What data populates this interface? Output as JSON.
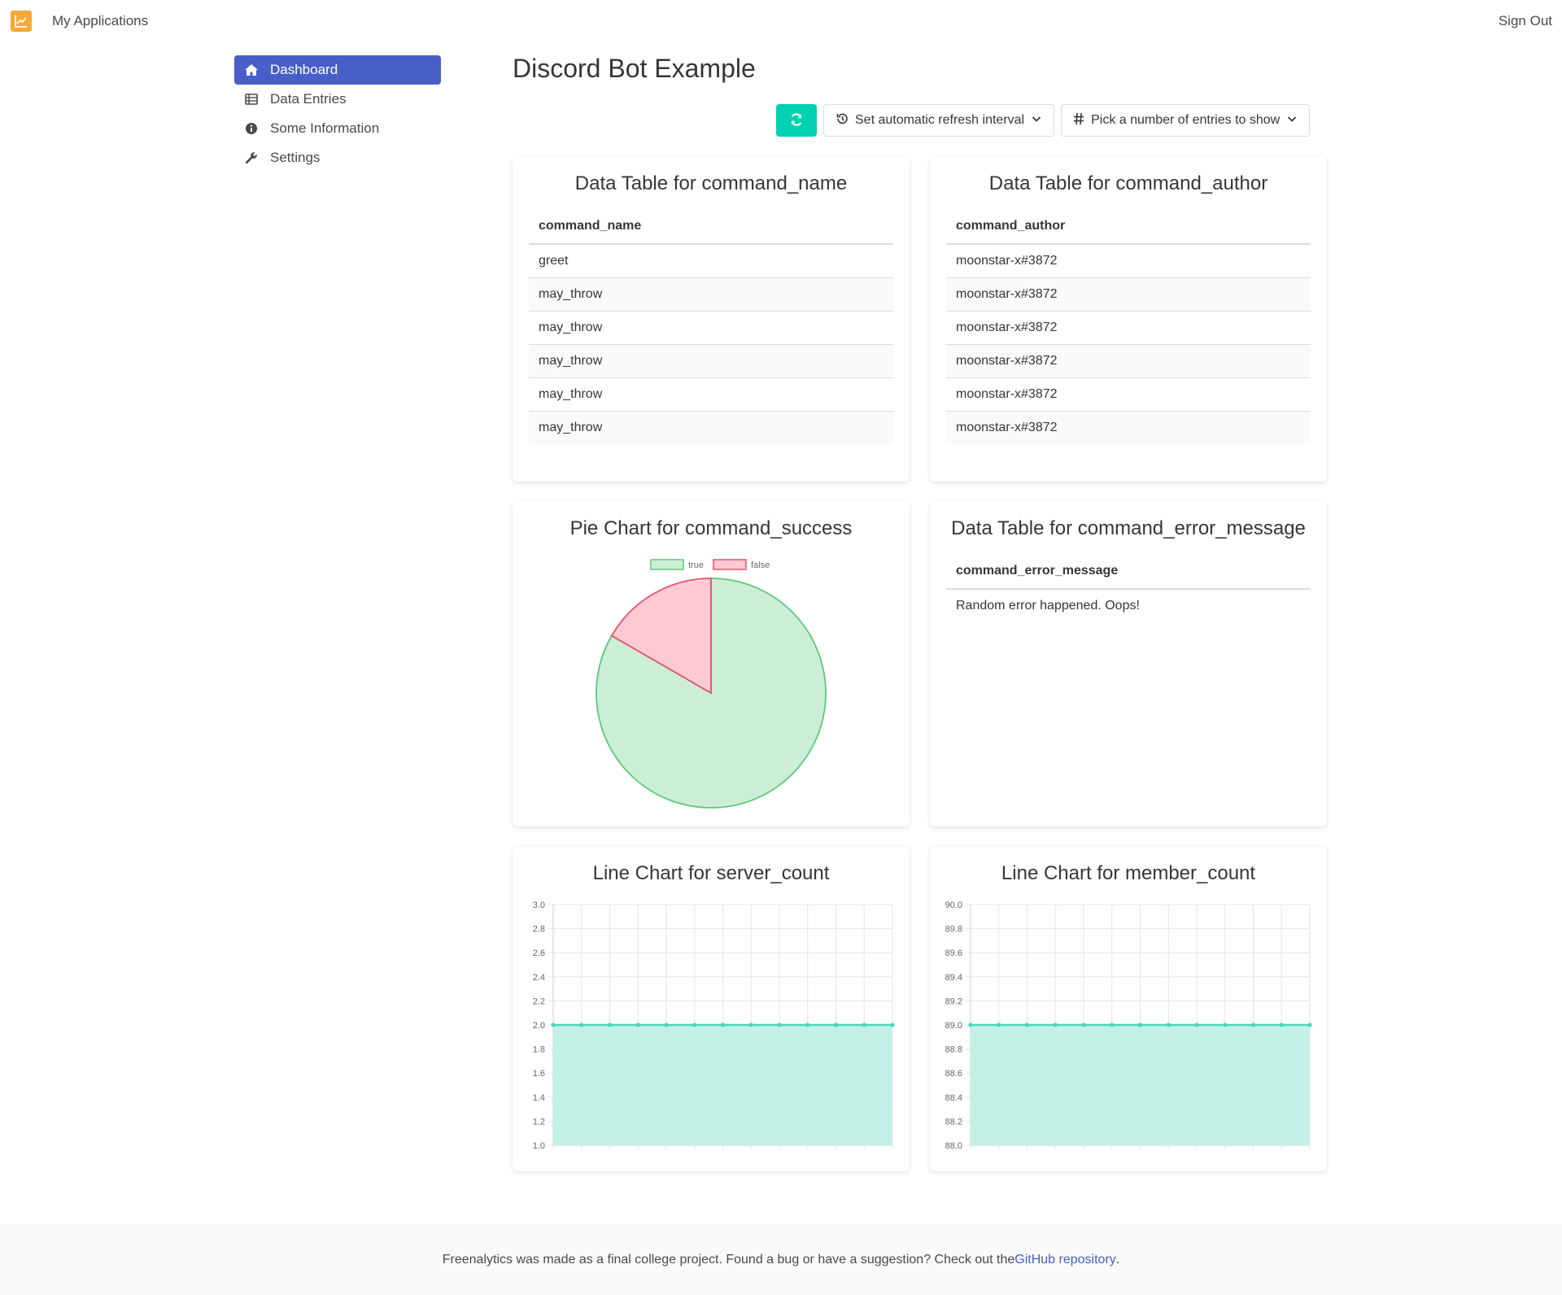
{
  "nav": {
    "app_label": "My Applications",
    "signout_label": "Sign Out",
    "logo_icon": "chart-line-icon",
    "logo_color": "#f6a836"
  },
  "sidebar": {
    "items": [
      {
        "label": "Dashboard",
        "icon": "home-icon",
        "active": true
      },
      {
        "label": "Data Entries",
        "icon": "table-icon",
        "active": false
      },
      {
        "label": "Some Information",
        "icon": "info-circle-icon",
        "active": false
      },
      {
        "label": "Settings",
        "icon": "wrench-icon",
        "active": false
      }
    ],
    "active_color": "#485fc7"
  },
  "page": {
    "title": "Discord Bot Example"
  },
  "toolbar": {
    "refresh_icon": "refresh-icon",
    "refresh_color": "#00d1b2",
    "interval_label": "Set automatic refresh interval",
    "entries_label": "Pick a number of entries to show"
  },
  "cards": {
    "command_name": {
      "title": "Data Table for command_name",
      "header": "command_name",
      "rows": [
        "greet",
        "may_throw",
        "may_throw",
        "may_throw",
        "may_throw",
        "may_throw"
      ]
    },
    "command_author": {
      "title": "Data Table for command_author",
      "header": "command_author",
      "rows": [
        "moonstar-x#3872",
        "moonstar-x#3872",
        "moonstar-x#3872",
        "moonstar-x#3872",
        "moonstar-x#3872",
        "moonstar-x#3872"
      ]
    },
    "command_success": {
      "title": "Pie Chart for command_success"
    },
    "command_error_message": {
      "title": "Data Table for command_error_message",
      "header": "command_error_message",
      "rows": [
        "Random error happened. Oops!"
      ]
    },
    "server_count": {
      "title": "Line Chart for server_count"
    },
    "member_count": {
      "title": "Line Chart for member_count"
    }
  },
  "chart_data": [
    {
      "type": "pie",
      "title": "Pie Chart for command_success",
      "categories": [
        "true",
        "false"
      ],
      "values": [
        5,
        1
      ],
      "colors": {
        "true": {
          "fill": "#cdeed6",
          "stroke": "#5cc97b"
        },
        "false": {
          "fill": "#ffcad4",
          "stroke": "#e3536a"
        }
      },
      "legend": "top"
    },
    {
      "type": "area",
      "title": "Line Chart for server_count",
      "x": [
        1,
        2,
        3,
        4,
        5,
        6,
        7,
        8,
        9,
        10,
        11,
        12,
        13
      ],
      "series": [
        {
          "values": [
            2,
            2,
            2,
            2,
            2,
            2,
            2,
            2,
            2,
            2,
            2,
            2,
            2
          ]
        }
      ],
      "ylim": [
        1.0,
        3.0
      ],
      "yticks": [
        "1.0",
        "1.2",
        "1.4",
        "1.6",
        "1.8",
        "2.0",
        "2.2",
        "2.4",
        "2.6",
        "2.8",
        "3.0"
      ],
      "grid": true,
      "line_color": "#4bd6bc",
      "fill_color": "#c1f0e6"
    },
    {
      "type": "area",
      "title": "Line Chart for member_count",
      "x": [
        1,
        2,
        3,
        4,
        5,
        6,
        7,
        8,
        9,
        10,
        11,
        12,
        13
      ],
      "series": [
        {
          "values": [
            89,
            89,
            89,
            89,
            89,
            89,
            89,
            89,
            89,
            89,
            89,
            89,
            89
          ]
        }
      ],
      "ylim": [
        88.0,
        90.0
      ],
      "yticks": [
        "88.0",
        "88.2",
        "88.4",
        "88.6",
        "88.8",
        "89.0",
        "89.2",
        "89.4",
        "89.6",
        "89.8",
        "90.0"
      ],
      "grid": true,
      "line_color": "#4bd6bc",
      "fill_color": "#c1f0e6"
    }
  ],
  "footer": {
    "text": "Freenalytics was made as a final college project. Found a bug or have a suggestion? Check out the ",
    "link_label": "GitHub repository",
    "end": "."
  }
}
